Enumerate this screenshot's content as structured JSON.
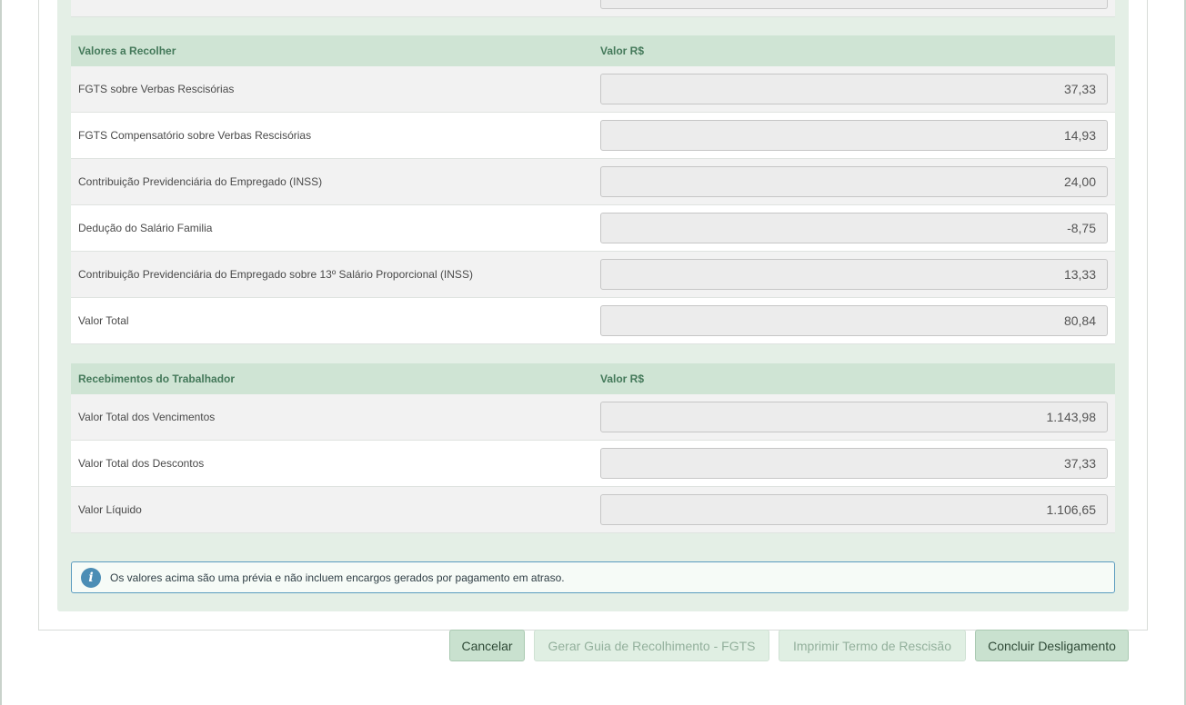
{
  "valores_recolher": {
    "header_label": "Valores a Recolher",
    "header_value": "Valor R$",
    "rows": [
      {
        "label": "FGTS sobre Verbas Rescisórias",
        "value": "37,33"
      },
      {
        "label": "FGTS Compensatório sobre Verbas Rescisórias",
        "value": "14,93"
      },
      {
        "label": "Contribuição Previdenciária do Empregado (INSS)",
        "value": "24,00"
      },
      {
        "label": "Dedução do Salário Familia",
        "value": "-8,75"
      },
      {
        "label": "Contribuição Previdenciária do Empregado sobre 13º Salário Proporcional (INSS)",
        "value": "13,33"
      },
      {
        "label": "Valor Total",
        "value": "80,84"
      }
    ]
  },
  "recebimentos": {
    "header_label": "Recebimentos do Trabalhador",
    "header_value": "Valor R$",
    "rows": [
      {
        "label": "Valor Total dos Vencimentos",
        "value": "1.143,98"
      },
      {
        "label": "Valor Total dos Descontos",
        "value": "37,33"
      },
      {
        "label": "Valor Líquido",
        "value": "1.106,65"
      }
    ]
  },
  "info": {
    "icon": "info-icon",
    "text": "Os valores acima são uma prévia e não incluem encargos gerados por pagamento em atraso."
  },
  "buttons": {
    "cancel": "Cancelar",
    "guia_fgts": "Gerar Guia de Recolhimento - FGTS",
    "termo": "Imprimir Termo de Rescisão",
    "concluir": "Concluir Desligamento"
  },
  "colors": {
    "panel_bg": "#e4efe6",
    "header_bg": "#cfe4d4",
    "header_text": "#44795a",
    "info_border": "#5a9bbf",
    "button_bg": "#c9e1cf"
  }
}
